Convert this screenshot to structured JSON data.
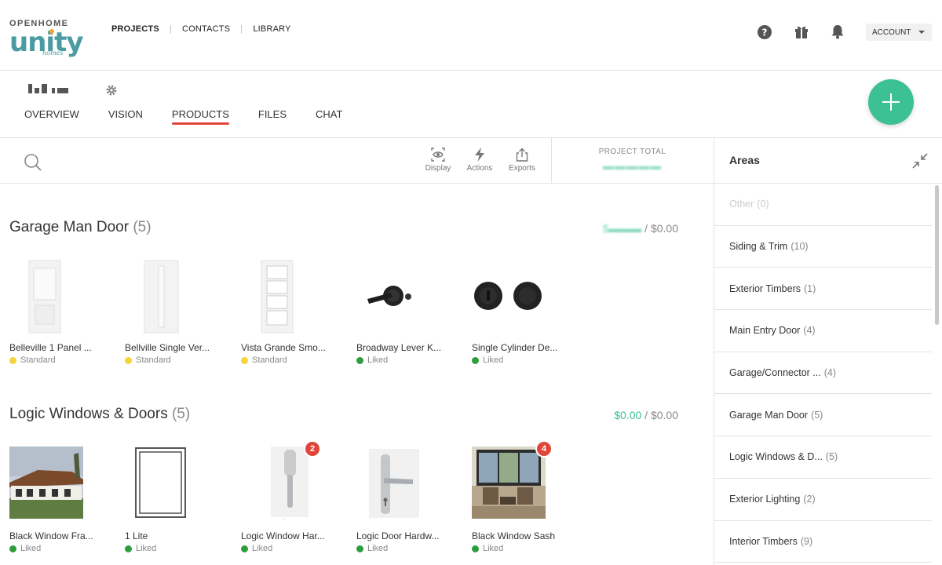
{
  "brand": {
    "top": "OPENHOME",
    "main": "unity",
    "sub": "homes"
  },
  "nav": {
    "items": [
      "PROJECTS",
      "CONTACTS",
      "LIBRARY"
    ],
    "active": 0
  },
  "header_icons": [
    "help-icon",
    "gift-icon",
    "bell-icon"
  ],
  "account": {
    "label": "ACCOUNT"
  },
  "project": {
    "tabs": [
      "OVERVIEW",
      "VISION",
      "PRODUCTS",
      "FILES",
      "CHAT"
    ],
    "active_tab": 2
  },
  "toolbar": {
    "display_label": "Display",
    "actions_label": "Actions",
    "exports_label": "Exports",
    "project_total_label": "PROJECT TOTAL"
  },
  "sections": [
    {
      "title": "Garage Man Door",
      "count": "(5)",
      "total_spent": "",
      "total_budget": "$0.00",
      "products": [
        {
          "name": "Belleville 1 Panel ...",
          "status": "Standard",
          "status_color": "#f5d33b",
          "image": "door-panel-image"
        },
        {
          "name": "Bellville Single Ver...",
          "status": "Standard",
          "status_color": "#f5d33b",
          "image": "door-narrow-image"
        },
        {
          "name": "Vista Grande Smo...",
          "status": "Standard",
          "status_color": "#f5d33b",
          "image": "door-4lite-image"
        },
        {
          "name": "Broadway Lever K...",
          "status": "Liked",
          "status_color": "#2e9e3c",
          "image": "lever-handle-image"
        },
        {
          "name": "Single Cylinder De...",
          "status": "Liked",
          "status_color": "#2e9e3c",
          "image": "deadbolt-image"
        }
      ]
    },
    {
      "title": "Logic Windows & Doors",
      "count": "(5)",
      "total_spent": "$0.00",
      "total_budget": "$0.00",
      "products": [
        {
          "name": "Black Window Fra...",
          "status": "Liked",
          "status_color": "#2e9e3c",
          "image": "house-photo-image",
          "badge": ""
        },
        {
          "name": "1 Lite",
          "status": "Liked",
          "status_color": "#2e9e3c",
          "image": "window-frame-image",
          "badge": ""
        },
        {
          "name": "Logic Window Har...",
          "status": "Liked",
          "status_color": "#2e9e3c",
          "image": "window-handle-image",
          "badge": "2"
        },
        {
          "name": "Logic Door Hardw...",
          "status": "Liked",
          "status_color": "#2e9e3c",
          "image": "door-handle-image",
          "badge": ""
        },
        {
          "name": "Black Window Sash",
          "status": "Liked",
          "status_color": "#2e9e3c",
          "image": "living-room-image",
          "badge": "4"
        }
      ]
    }
  ],
  "areas": {
    "title": "Areas",
    "items": [
      {
        "label": "Other",
        "count": "(0)",
        "disabled": true
      },
      {
        "label": "Siding & Trim",
        "count": "(10)"
      },
      {
        "label": "Exterior Timbers",
        "count": "(1)"
      },
      {
        "label": "Main Entry Door",
        "count": "(4)"
      },
      {
        "label": "Garage/Connector ...",
        "count": "(4)"
      },
      {
        "label": "Garage Man Door",
        "count": "(5)"
      },
      {
        "label": "Logic Windows & D...",
        "count": "(5)"
      },
      {
        "label": "Exterior Lighting",
        "count": "(2)"
      },
      {
        "label": "Interior Timbers",
        "count": "(9)"
      }
    ]
  },
  "colors": {
    "accent": "#3cc194",
    "active_tab_underline": "#e0453a",
    "badge": "#e0453a",
    "brand": "#4b9ba2"
  }
}
